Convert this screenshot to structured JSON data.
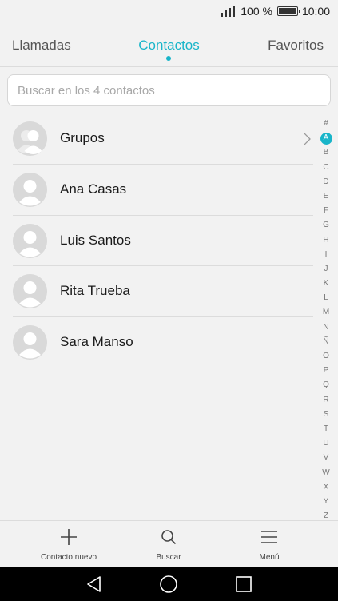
{
  "status_bar": {
    "battery_label": "100 %",
    "battery_level": 1.0,
    "time": "10:00"
  },
  "tabs": {
    "calls": "Llamadas",
    "contacts": "Contactos",
    "favorites": "Favoritos",
    "active": "contacts"
  },
  "search": {
    "placeholder": "Buscar en los 4 contactos"
  },
  "contacts": [
    {
      "label": "Grupos",
      "type": "group"
    },
    {
      "label": "Ana Casas",
      "type": "contact"
    },
    {
      "label": "Luis Santos",
      "type": "contact"
    },
    {
      "label": "Rita Trueba",
      "type": "contact"
    },
    {
      "label": "Sara Manso",
      "type": "contact"
    }
  ],
  "alphabet_index": [
    "#",
    "A",
    "B",
    "C",
    "D",
    "E",
    "F",
    "G",
    "H",
    "I",
    "J",
    "K",
    "L",
    "M",
    "N",
    "Ñ",
    "O",
    "P",
    "Q",
    "R",
    "S",
    "T",
    "U",
    "V",
    "W",
    "X",
    "Y",
    "Z"
  ],
  "alphabet_active": "A",
  "toolbar": {
    "new_contact": "Contacto nuevo",
    "search": "Buscar",
    "menu": "Menú"
  },
  "colors": {
    "accent": "#19b5c9",
    "background": "#f2f2f2"
  }
}
